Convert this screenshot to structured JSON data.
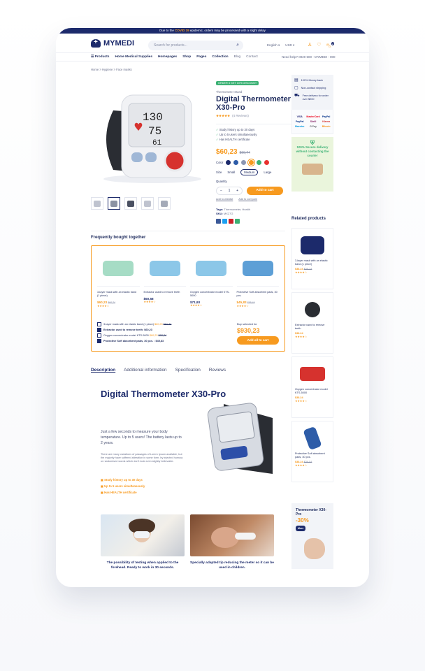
{
  "topbar": {
    "pre": "Due to the ",
    "hl": "COVID 19",
    "post": " epidemic, orders may be processed with a slight delay"
  },
  "header": {
    "logo": "MYMEDI",
    "search_placeholder": "Search for products...",
    "lang": "English",
    "currency": "USD",
    "cart_count": "2"
  },
  "nav": {
    "items": [
      "Products",
      "Home Medical Supplies",
      "Homepages",
      "Shop",
      "Pages",
      "Collection",
      "Blog",
      "Contact"
    ],
    "phone": "Need help? 0020 500 - MYMEDI - 000"
  },
  "breadcrumb": "Home  >  Hygiene  >  Face masks",
  "product": {
    "badge": "ORDER 3 GET 10% DISCOUNT",
    "brand": "Thermometer Stand",
    "title": "Digital Thermometer X30-Pro",
    "stars": "★★★★★",
    "reviews": "(4 Reviews)",
    "features": [
      "Study history up to 30 days",
      "Up to 5 users simultaneously",
      "Has HEALTH certificate"
    ],
    "price": "$60,23",
    "old_price": "$60,74",
    "color_label": "Color",
    "size_label": "Size",
    "sizes": [
      "Small",
      "Medium",
      "Large"
    ],
    "quantity_label": "Quantity",
    "qty": "1",
    "add_to_cart": "Add to cart",
    "wishlist": "Add to wishlist",
    "compare": "Add to compare",
    "tags_label": "Tags:",
    "tags": "Thermometer, Health",
    "sku_label": "SKU:",
    "sku": "MX27G",
    "device_screen": [
      "130",
      "75",
      "61"
    ]
  },
  "colors": [
    "#1c2a6b",
    "#2d5ca8",
    "#8c96b2",
    "#f79a1f",
    "#3bb174",
    "#e8312f"
  ],
  "benefits": [
    {
      "icon": "▤",
      "text": "100% Money back"
    },
    {
      "icon": "▢",
      "text": "Non-contact shipping"
    },
    {
      "icon": "⛟",
      "text": "Free delivery for order over $200"
    }
  ],
  "payments": [
    "VISA",
    "MasterCard",
    "PayPal",
    "PayPal",
    "Skrill",
    "Klarna",
    "Maestro",
    "G Pay",
    "Bitcoin"
  ],
  "promo1": "100% Secure delivery without contacting the courier",
  "related": {
    "heading": "Related products",
    "items": [
      {
        "name": "3-layer mask with an elastic band (1 piece)",
        "price": "$38.24",
        "old": "$38.24",
        "stars": "★★★★☆"
      },
      {
        "name": "Extractor used to remove teeth",
        "price": "$38.24",
        "old": "",
        "stars": "★★★★☆"
      },
      {
        "name": "Oxygen concentrator model KTS-5000",
        "price": "$38.24",
        "old": "",
        "stars": "★★★★☆"
      },
      {
        "name": "Protective Soft absorbent pads, 30 pcs.",
        "price": "$38.24",
        "old": "$38.54",
        "stars": "★★★★☆"
      }
    ]
  },
  "fbt": {
    "heading": "Frequently bought together",
    "items": [
      {
        "name": "3-layer mask with an elastic band (1 piece)",
        "price": "$60,23",
        "old": "$60,74",
        "stars": "★★★★☆"
      },
      {
        "name": "Extractor used to remove teeth",
        "price": "$50,58",
        "old": "",
        "stars": "★★★★☆"
      },
      {
        "name": "Oxygen concentrator model KTS-5000",
        "price": "$71,93",
        "old": "",
        "stars": "★★★★☆"
      },
      {
        "name": "Protective Soft absorbent pads, 30 pcs.",
        "price": "$45,83",
        "old": "$55,49",
        "stars": "★★★★☆"
      }
    ],
    "list": [
      {
        "text": "3-layer mask with an elastic band (1 piece)  ",
        "price": "$60,23",
        "old": "$91,74",
        "checked": false
      },
      {
        "text": "Extractor used to remove teeth: $60,23",
        "price": "",
        "old": "",
        "checked": true
      },
      {
        "text": "Oxygen concentrator model KTS-5000  ",
        "price": "$60,23",
        "old": "$37,74",
        "checked": false
      },
      {
        "text": "Protective Soft absorbent pads, 30 pcs. : $45,83",
        "price": "",
        "old": "",
        "checked": true
      }
    ],
    "total_label": "Buy selected for",
    "total": "$930,23",
    "add_all": "Add all to cart"
  },
  "tabs": [
    "Description",
    "Additional information",
    "Specification",
    "Reviews"
  ],
  "desc": {
    "title": "Digital Thermometer X30-Pro",
    "lead": "Just a few seconds to measure your body temperature. Up to 5 users! The battery lasts up to 2 years.",
    "small": "There are many variations of passages of Lorem Ipsum available, but the majority have suffered alteration in some form, by injected humour, or randomised words which don't look even slightly believable.",
    "bullets": [
      "Study history up to 30 days",
      "Up to 5 users simultaneously",
      "Has HEALTH certificate"
    ],
    "cap1": "The possibility of testing when applied to the forehead. Ready to work in 30 seconds.",
    "cap2": "Specially adapted tip reducing the meter so it can be used in children."
  },
  "promo2": {
    "title": "Thermometer X30-Pro",
    "pct": "-30%",
    "btn": "More"
  }
}
